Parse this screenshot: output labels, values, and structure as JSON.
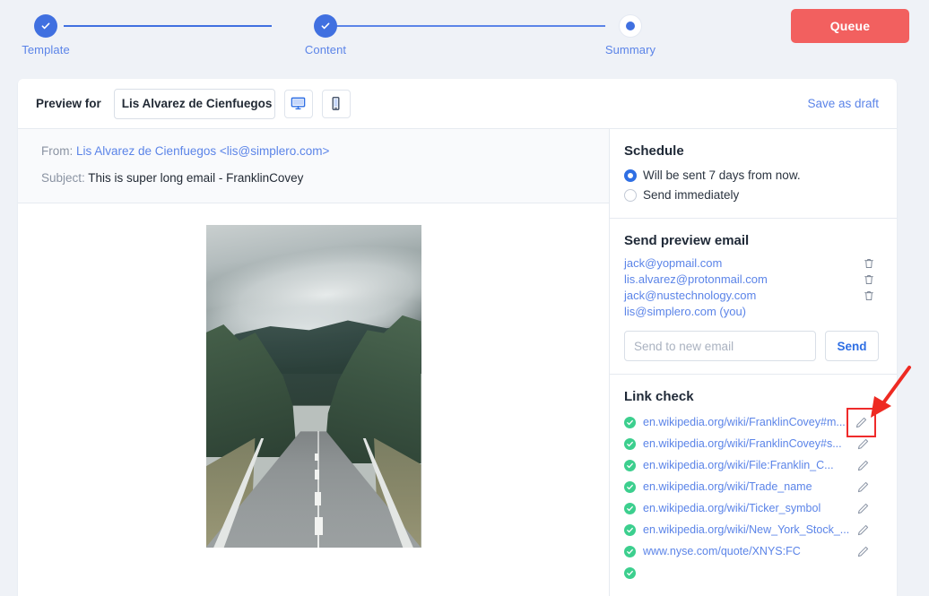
{
  "stepper": {
    "steps": [
      {
        "label": "Template",
        "state": "done",
        "icon": "check-icon"
      },
      {
        "label": "Content",
        "state": "done",
        "icon": "check-icon"
      },
      {
        "label": "Summary",
        "state": "current",
        "icon": "dot-icon"
      }
    ],
    "queue_button": "Queue"
  },
  "card": {
    "preview_for_label": "Preview for",
    "recipient_name": "Lis Alvarez de Cienfuegos",
    "device_desktop_icon": "desktop-monitor-icon",
    "device_mobile_icon": "mobile-phone-icon",
    "save_as_draft": "Save as draft"
  },
  "mail": {
    "from_label": "From:",
    "from_value": "Lis Alvarez de Cienfuegos <lis@simplero.com>",
    "subject_label": "Subject:",
    "subject_value": "This is super long email - FranklinCovey",
    "hero_image_alt": "road-through-forest-photo"
  },
  "schedule": {
    "title": "Schedule",
    "options": [
      {
        "label": "Will be sent 7 days from now.",
        "selected": true
      },
      {
        "label": "Send immediately",
        "selected": false
      }
    ]
  },
  "preview_email": {
    "title": "Send preview email",
    "recipients": [
      {
        "address": "jack@yopmail.com",
        "deletable": true
      },
      {
        "address": "lis.alvarez@protonmail.com",
        "deletable": true
      },
      {
        "address": "jack@nustechnology.com",
        "deletable": true
      },
      {
        "address": "lis@simplero.com (you)",
        "deletable": false
      }
    ],
    "input_placeholder": "Send to new email",
    "input_value": "",
    "send_button": "Send"
  },
  "link_check": {
    "title": "Link check",
    "links": [
      {
        "url": "en.wikipedia.org/wiki/FranklinCovey#m...",
        "status": "ok",
        "highlighted": true
      },
      {
        "url": "en.wikipedia.org/wiki/FranklinCovey#s...",
        "status": "ok",
        "highlighted": false
      },
      {
        "url": "en.wikipedia.org/wiki/File:Franklin_C...",
        "status": "ok",
        "highlighted": false
      },
      {
        "url": "en.wikipedia.org/wiki/Trade_name",
        "status": "ok",
        "highlighted": false
      },
      {
        "url": "en.wikipedia.org/wiki/Ticker_symbol",
        "status": "ok",
        "highlighted": false
      },
      {
        "url": "en.wikipedia.org/wiki/New_York_Stock_...",
        "status": "ok",
        "highlighted": false
      },
      {
        "url": "www.nyse.com/quote/XNYS:FC",
        "status": "ok",
        "highlighted": false
      }
    ]
  },
  "annotation": {
    "arrow_color": "#ee2a22",
    "highlight_color": "#ef2b2b",
    "target": "edit-link-pencil-icon"
  },
  "colors": {
    "accent_blue": "#4070e0",
    "link_blue": "#5b84e8",
    "queue_red": "#f2605f",
    "status_green": "#3ccf8e",
    "page_bg": "#eff2f7"
  }
}
